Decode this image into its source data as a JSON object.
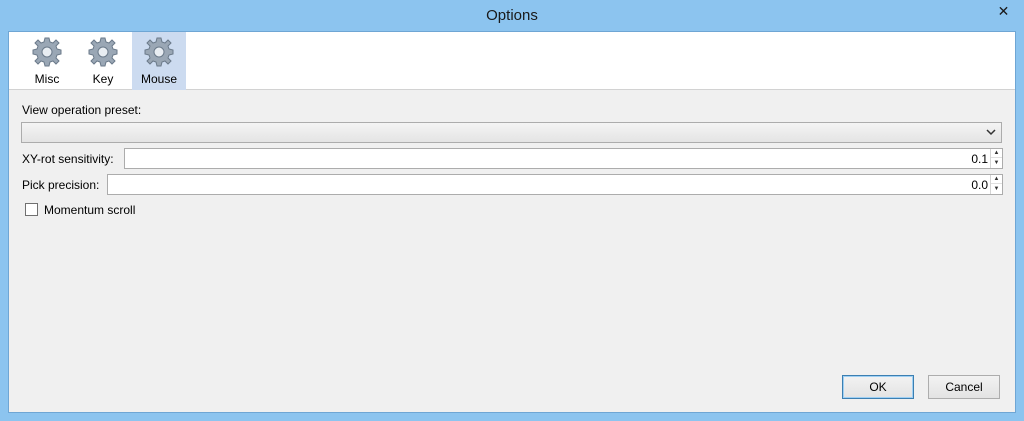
{
  "window": {
    "title": "Options",
    "close_glyph": "✕"
  },
  "toolbar": {
    "items": [
      {
        "label": "Misc",
        "icon": "gear-icon",
        "selected": false
      },
      {
        "label": "Key",
        "icon": "gear-icon",
        "selected": false
      },
      {
        "label": "Mouse",
        "icon": "gear-icon",
        "selected": true
      }
    ]
  },
  "mouse": {
    "preset_label": "View operation preset:",
    "preset_value": "",
    "xy_rot_label": "XY-rot sensitivity:",
    "xy_rot_value": "0.1",
    "pick_label": "Pick precision:",
    "pick_value": "0.0",
    "momentum_label": "Momentum scroll",
    "momentum_checked": false
  },
  "buttons": {
    "ok": "OK",
    "cancel": "Cancel"
  },
  "colors": {
    "title_bar": "#8cc4ef",
    "selected_tool": "#ccdbf0",
    "client": "#f0f0f0"
  }
}
